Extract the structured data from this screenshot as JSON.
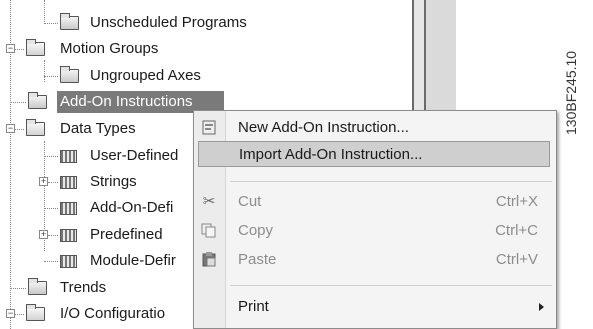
{
  "tree": {
    "items": [
      {
        "label": "Unscheduled Programs"
      },
      {
        "label": "Motion Groups"
      },
      {
        "label": "Ungrouped Axes"
      },
      {
        "label": "Add-On Instructions"
      },
      {
        "label": "Data Types"
      },
      {
        "label": "User-Defined"
      },
      {
        "label": "Strings"
      },
      {
        "label": "Add-On-Defi"
      },
      {
        "label": "Predefined"
      },
      {
        "label": "Module-Defir"
      },
      {
        "label": "Trends"
      },
      {
        "label": "I/O Configuratio"
      }
    ]
  },
  "context_menu": {
    "items": [
      {
        "label": "New Add-On Instruction...",
        "shortcut": "",
        "icon": "new-document-icon"
      },
      {
        "label": "Import Add-On Instruction...",
        "shortcut": "",
        "icon": ""
      },
      {
        "label": "Cut",
        "shortcut": "Ctrl+X",
        "icon": "scissors-icon"
      },
      {
        "label": "Copy",
        "shortcut": "Ctrl+C",
        "icon": "copy-icon"
      },
      {
        "label": "Paste",
        "shortcut": "Ctrl+V",
        "icon": "clipboard-icon"
      },
      {
        "label": "Print",
        "shortcut": "",
        "icon": "submenu-arrow"
      }
    ]
  },
  "figure_id": "130BF245.10"
}
